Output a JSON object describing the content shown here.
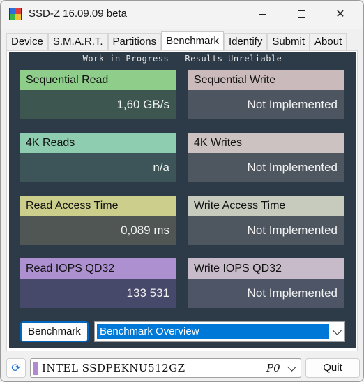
{
  "window": {
    "title": "SSD-Z 16.09.09 beta"
  },
  "tabs": [
    "Device",
    "S.M.A.R.T.",
    "Partitions",
    "Benchmark",
    "Identify",
    "Submit",
    "About"
  ],
  "active_tab": "Benchmark",
  "banner": "Work in Progress - Results Unreliable",
  "cards": {
    "seq_read": {
      "label": "Sequential Read",
      "value": "1,60 GB/s",
      "head_color": "#8fce8a",
      "body_color": "#3d5650"
    },
    "seq_write": {
      "label": "Sequential Write",
      "value": "Not Implemented",
      "head_color": "#cbbabb",
      "body_color": "#4d5560"
    },
    "k4_reads": {
      "label": "4K Reads",
      "value": "n/a",
      "head_color": "#8fcdb0",
      "body_color": "#3d5558"
    },
    "k4_writes": {
      "label": "4K Writes",
      "value": "Not Implemented",
      "head_color": "#ccc2c1",
      "body_color": "#4e5660"
    },
    "read_access": {
      "label": "Read Access Time",
      "value": "0,089 ms",
      "head_color": "#cccf8c",
      "body_color": "#4f5654"
    },
    "write_access": {
      "label": "Write Access Time",
      "value": "Not Implemented",
      "head_color": "#c7cbbe",
      "body_color": "#4e5660"
    },
    "read_iops": {
      "label": "Read IOPS QD32",
      "value": "133 531",
      "head_color": "#ac90cf",
      "body_color": "#47496a"
    },
    "write_iops": {
      "label": "Write IOPS QD32",
      "value": "Not Implemented",
      "head_color": "#c8bbc9",
      "body_color": "#4e5566"
    }
  },
  "benchmark_button": "Benchmark",
  "benchmark_select": {
    "value": "Benchmark Overview"
  },
  "drive": {
    "name": "INTEL SSDPEKNU512GZ",
    "port": "P0"
  },
  "quit_button": "Quit",
  "colors": {
    "panel_bg": "#2d3a47",
    "accent": "#0078d7"
  }
}
